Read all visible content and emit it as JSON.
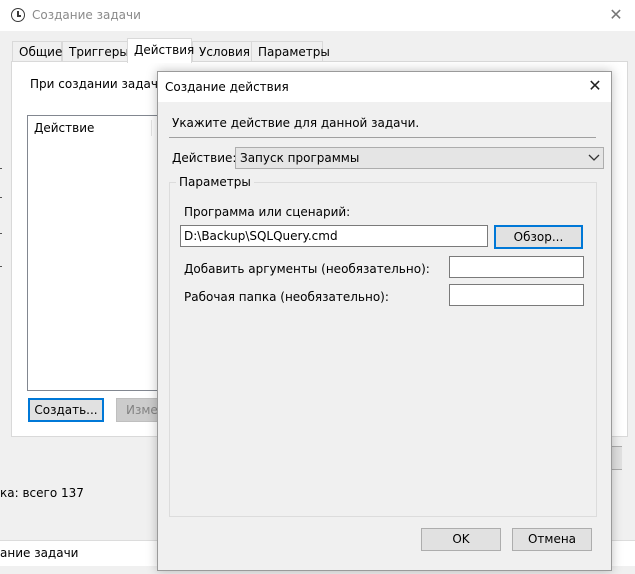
{
  "background_window": {
    "title": "Создание задачи",
    "tabs": [
      {
        "label": "Общие"
      },
      {
        "label": "Триггеры"
      },
      {
        "label": "Действия"
      },
      {
        "label": "Условия"
      },
      {
        "label": "Параметры"
      }
    ],
    "active_tab": "Действия",
    "hint_text": "При создании задачи н",
    "list_header": "Действие",
    "create_button": "Создать...",
    "edit_button": "Изме",
    "count_text": "ка: всего 137",
    "status_text": "ание задачи"
  },
  "dialog": {
    "title": "Создание действия",
    "close_glyph": "✕",
    "hint": "Укажите действие для данной задачи.",
    "action_label": "Действие:",
    "action_value": "Запуск программы",
    "params_legend": "Параметры",
    "program_label": "Программа или сценарий:",
    "program_value": "D:\\Backup\\SQLQuery.cmd",
    "browse_button": "Обзор...",
    "args_label": "Добавить аргументы (необязательно):",
    "args_value": "",
    "dir_label": "Рабочая папка (необязательно):",
    "dir_value": "",
    "ok_button": "OK",
    "cancel_button": "Отмена"
  },
  "colors": {
    "focus_border": "#0078d7",
    "window_bg": "#f0f0f0",
    "button_bg": "#e1e1e1"
  },
  "icons": {
    "bg_title_icon": "task-clock-icon",
    "close": "close-icon",
    "dropdown": "chevron-down-icon"
  }
}
